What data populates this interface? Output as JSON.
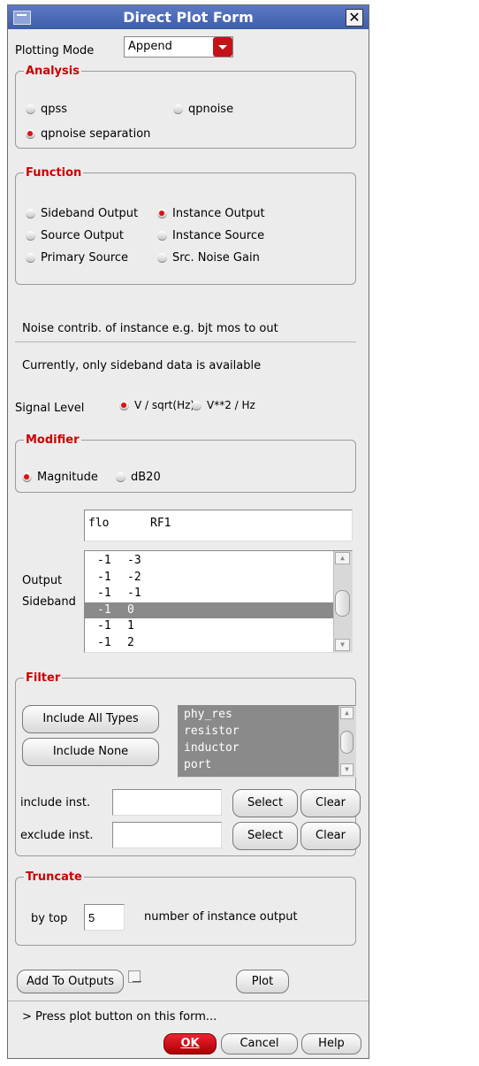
{
  "window": {
    "title": "Direct Plot Form",
    "close_glyph": "✕"
  },
  "plotting_mode": {
    "label": "Plotting Mode",
    "value": "Append"
  },
  "analysis": {
    "legend": "Analysis",
    "options": [
      "qpss",
      "qpnoise",
      "qpnoise separation"
    ],
    "selected": "qpnoise separation"
  },
  "function": {
    "legend": "Function",
    "options": [
      "Sideband Output",
      "Instance Output",
      "Source Output",
      "Instance Source",
      "Primary Source",
      "Src. Noise Gain"
    ],
    "selected": "Instance Output"
  },
  "info": {
    "description": "Noise contrib. of instance e.g. bjt mos to out",
    "note": "Currently, only sideband data is available"
  },
  "signal_level": {
    "label": "Signal Level",
    "options": [
      "V / sqrt(Hz)",
      "V**2 / Hz"
    ],
    "selected": "V / sqrt(Hz)"
  },
  "modifier": {
    "legend": "Modifier",
    "options": [
      "Magnitude",
      "dB20"
    ],
    "selected": "Magnitude"
  },
  "output_sideband": {
    "label_line1": "Output",
    "label_line2": "Sideband",
    "header_col1": "flo",
    "header_col2": "RF1",
    "rows": [
      {
        "a": "-1",
        "b": "-3"
      },
      {
        "a": "-1",
        "b": "-2"
      },
      {
        "a": "-1",
        "b": "-1"
      },
      {
        "a": "-1",
        "b": "0"
      },
      {
        "a": "-1",
        "b": "1"
      },
      {
        "a": "-1",
        "b": "2"
      }
    ],
    "selected_index": 3
  },
  "filter": {
    "legend": "Filter",
    "include_all_label": "Include All Types",
    "include_none_label": "Include None",
    "types": [
      "phy_res",
      "resistor",
      "inductor",
      "port"
    ],
    "include_inst_label": "include inst.",
    "exclude_inst_label": "exclude inst.",
    "include_inst_value": "",
    "exclude_inst_value": "",
    "select_label": "Select",
    "clear_label": "Clear"
  },
  "truncate": {
    "legend": "Truncate",
    "by_label": "by top",
    "value": "5",
    "suffix": "number of instance output"
  },
  "actions": {
    "add_to_outputs": "Add To Outputs",
    "plot": "Plot",
    "status": "> Press plot button on this form...",
    "ok": "OK",
    "cancel": "Cancel",
    "help": "Help"
  },
  "colors": {
    "accent": "#cc0000",
    "title_bar": "#4a68b4",
    "selection": "#8a8a8a"
  }
}
